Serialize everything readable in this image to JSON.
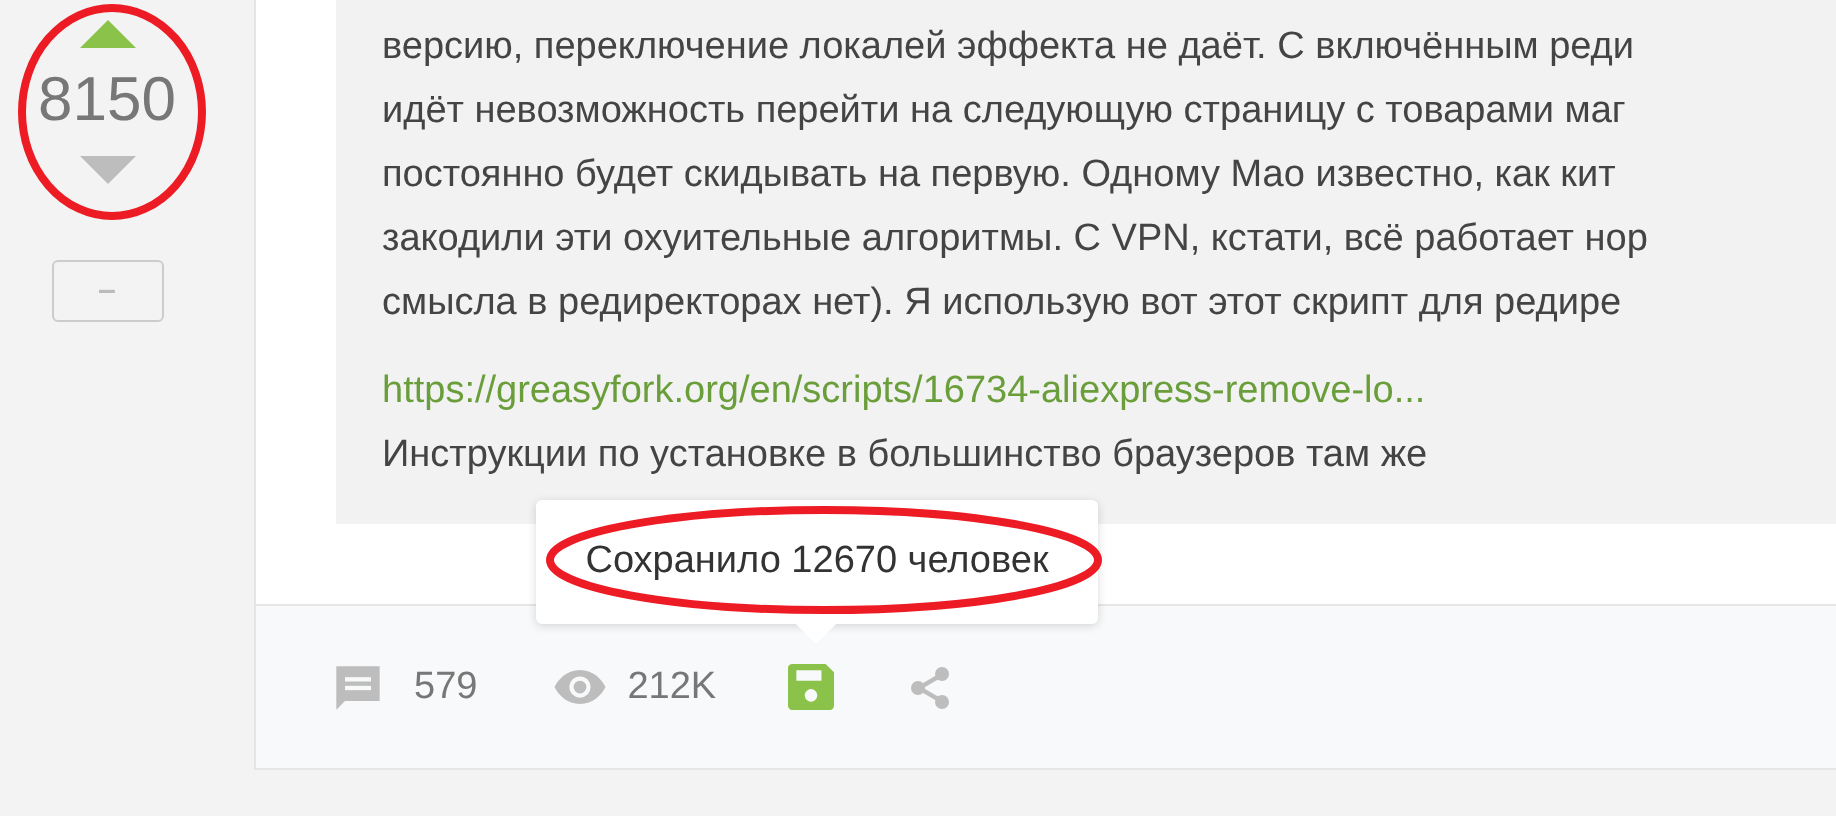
{
  "vote": {
    "score": "8150",
    "upvoted": true,
    "downvoted": false,
    "minus_label": "–"
  },
  "quote": {
    "lines": [
      "версию, переключение локалей эффекта не даёт. С включённым реди",
      "идёт невозможность перейти на следующую страницу с товарами маг",
      "постоянно будет скидывать на первую. Одному Мао известно, как кит",
      "закодили эти охуительные алгоритмы. С VPN, кстати, всё работает нор",
      "смысла в редиректорах нет). Я использую вот этот скрипт для редире"
    ],
    "link": "https://greasyfork.org/en/scripts/16734-aliexpress-remove-lo...",
    "after": "Инструкции по установке в большинство браузеров там же"
  },
  "tooltip": "Сохранило 12670 человек",
  "footer": {
    "comments": "579",
    "views": "212K",
    "saved": true
  }
}
